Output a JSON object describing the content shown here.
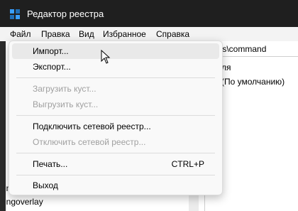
{
  "window": {
    "title": "Редактор реестра"
  },
  "menubar": {
    "items": [
      "Файл",
      "Правка",
      "Вид",
      "Избранное",
      "Справка"
    ]
  },
  "address": {
    "value": "nas\\command"
  },
  "right_pane": {
    "header_fragment": "ля",
    "default_value": "(По умолчанию)"
  },
  "tree": {
    "item_last": "ingoverlay"
  },
  "file_menu": {
    "items": [
      {
        "label": "Импорт...",
        "shortcut": "",
        "enabled": true,
        "hovered": true
      },
      {
        "label": "Экспорт...",
        "shortcut": "",
        "enabled": true
      },
      {
        "label": "Загрузить куст...",
        "shortcut": "",
        "enabled": false
      },
      {
        "label": "Выгрузить куст...",
        "shortcut": "",
        "enabled": false
      },
      {
        "label": "Подключить сетевой реестр...",
        "shortcut": "",
        "enabled": true
      },
      {
        "label": "Отключить сетевой реестр...",
        "shortcut": "",
        "enabled": false
      },
      {
        "label": "Печать...",
        "shortcut": "CTRL+P",
        "enabled": true
      },
      {
        "label": "Выход",
        "shortcut": "",
        "enabled": true
      }
    ]
  },
  "colors": {
    "titlebar": "#1f1f1f",
    "menubar": "#f3f3f3",
    "menu_bg": "#f9f9f9",
    "hover": "#e9e9e9",
    "disabled_text": "#a0a0a0"
  }
}
